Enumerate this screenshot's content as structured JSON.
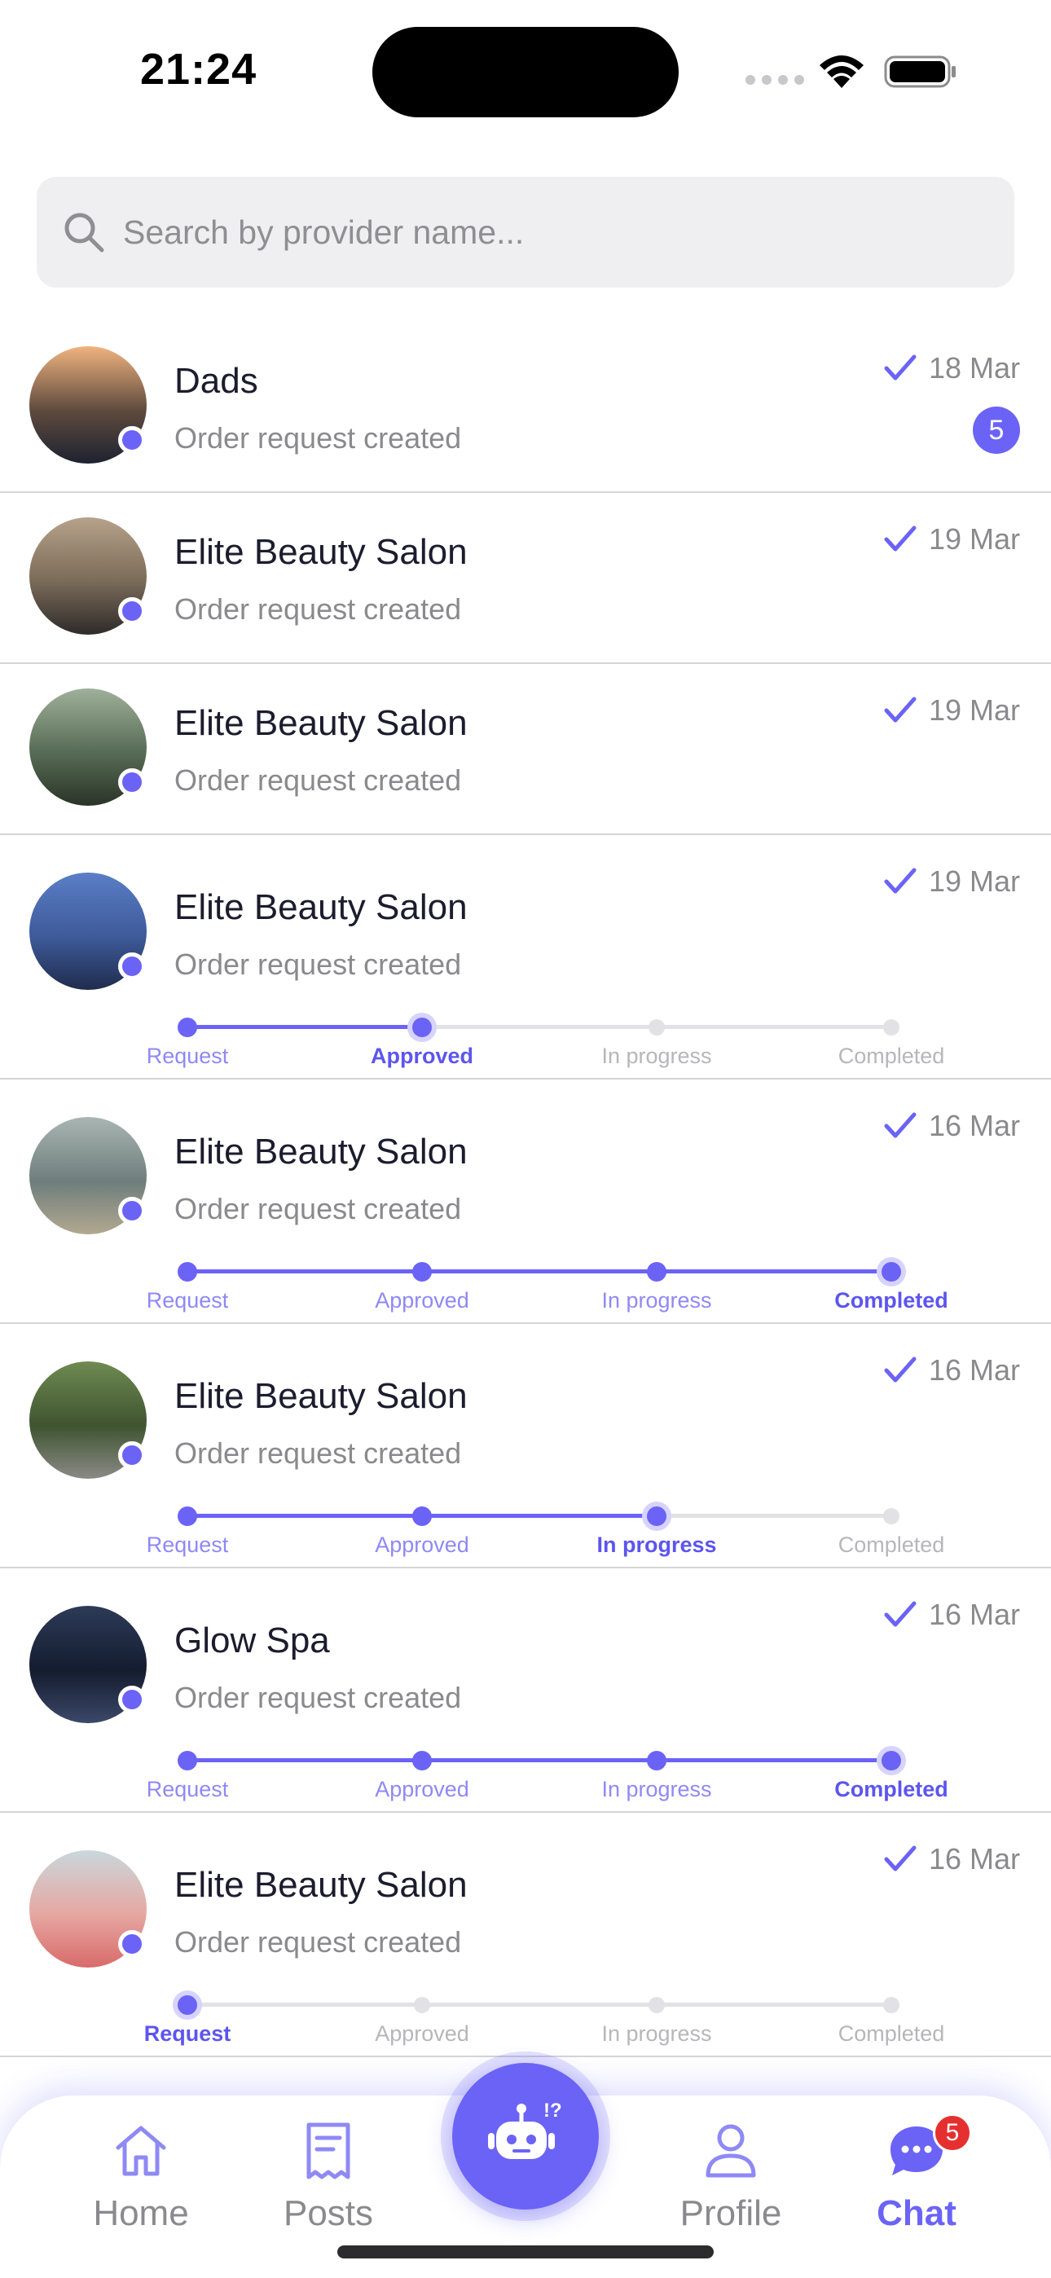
{
  "status_bar": {
    "time": "21:24"
  },
  "search": {
    "placeholder": "Search by provider name..."
  },
  "tracker_steps": [
    "Request",
    "Approved",
    "In progress",
    "Completed"
  ],
  "chats": [
    {
      "name": "Dads",
      "preview": "Order request created",
      "date": "18 Mar",
      "unread": "5",
      "avatar_colors": [
        "#f0b37e",
        "#5e4a3e",
        "#1e2230"
      ],
      "progress_step": null
    },
    {
      "name": "Elite Beauty Salon",
      "preview": "Order request created",
      "date": "19 Mar",
      "unread": null,
      "avatar_colors": [
        "#b7a28a",
        "#7a6a58",
        "#2e2b2a"
      ],
      "progress_step": null
    },
    {
      "name": "Elite Beauty Salon",
      "preview": "Order request created",
      "date": "19 Mar",
      "unread": null,
      "avatar_colors": [
        "#9fb09a",
        "#566b55",
        "#2a3427"
      ],
      "progress_step": null
    },
    {
      "name": "Elite Beauty Salon",
      "preview": "Order request created",
      "date": "19 Mar",
      "unread": null,
      "avatar_colors": [
        "#5b7ec6",
        "#3e5a9a",
        "#1f2c4d"
      ],
      "progress_step": 1
    },
    {
      "name": "Elite Beauty Salon",
      "preview": "Order request created",
      "date": "16 Mar",
      "unread": null,
      "avatar_colors": [
        "#a9b5b3",
        "#6e7e7c",
        "#b2a890"
      ],
      "progress_step": 3
    },
    {
      "name": "Elite Beauty Salon",
      "preview": "Order request created",
      "date": "16 Mar",
      "unread": null,
      "avatar_colors": [
        "#6f8a52",
        "#3f5430",
        "#8a8a86"
      ],
      "progress_step": 2
    },
    {
      "name": "Glow Spa",
      "preview": "Order request created",
      "date": "16 Mar",
      "unread": null,
      "avatar_colors": [
        "#2d3b58",
        "#141c2e",
        "#3b4868"
      ],
      "progress_step": 3
    },
    {
      "name": "Elite Beauty Salon",
      "preview": "Order request created",
      "date": "16 Mar",
      "unread": null,
      "avatar_colors": [
        "#c9d7dc",
        "#e6a7a1",
        "#d86a6a"
      ],
      "progress_step": 0
    }
  ],
  "tabs": {
    "home": "Home",
    "posts": "Posts",
    "profile": "Profile",
    "chat": "Chat",
    "chat_badge": "5"
  },
  "colors": {
    "accent": "#6b63f6",
    "badge_red": "#e5302f"
  }
}
